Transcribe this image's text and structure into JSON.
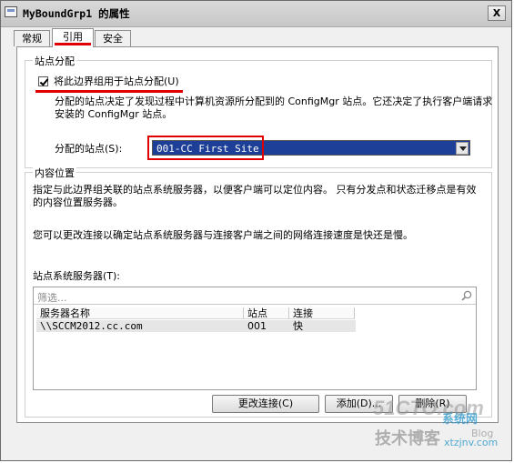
{
  "window": {
    "title": "MyBoundGrp1 的属性",
    "close_label": "X"
  },
  "tabs": [
    {
      "label": "常规"
    },
    {
      "label": "引用"
    },
    {
      "label": "安全"
    }
  ],
  "site_assignment": {
    "group_label": "站点分配",
    "checkbox_label": "将此边界组用于站点分配(U)",
    "checked": true,
    "description_line1": "分配的站点决定了发现过程中计算机资源所分配到的 ConfigMgr 站点。它还决定了执行客户端请求",
    "description_line2": "安装的 ConfigMgr 站点。",
    "assigned_site_label": "分配的站点(S):",
    "assigned_site_value": "001-CC First Site"
  },
  "content_location": {
    "group_label": "内容位置",
    "description_line1": "指定与此边界组关联的站点系统服务器，以便客户端可以定位内容。  只有分发点和状态迁移点是有效",
    "description_line2": "的内容位置服务器。",
    "speed_note": "您可以更改连接以确定站点系统服务器与连接客户端之间的网络连接速度是快还是慢。",
    "servers_label": "站点系统服务器(T):",
    "filter_placeholder": "筛选...",
    "columns": [
      "服务器名称",
      "站点",
      "连接"
    ],
    "rows": [
      [
        "\\\\SCCM2012.cc.com",
        "001",
        "快"
      ]
    ],
    "buttons": {
      "change": "更改连接(C)",
      "add": "添加(D)...",
      "remove": "删除(R)"
    }
  },
  "watermark": {
    "line1": "51CTO.com",
    "line2": "技术博客",
    "line3": "Blog",
    "brand": "系统网",
    "site": "xtzjnv.com"
  },
  "colors": {
    "highlight_red": "#e00000",
    "select_bg": "#1d3f97"
  }
}
